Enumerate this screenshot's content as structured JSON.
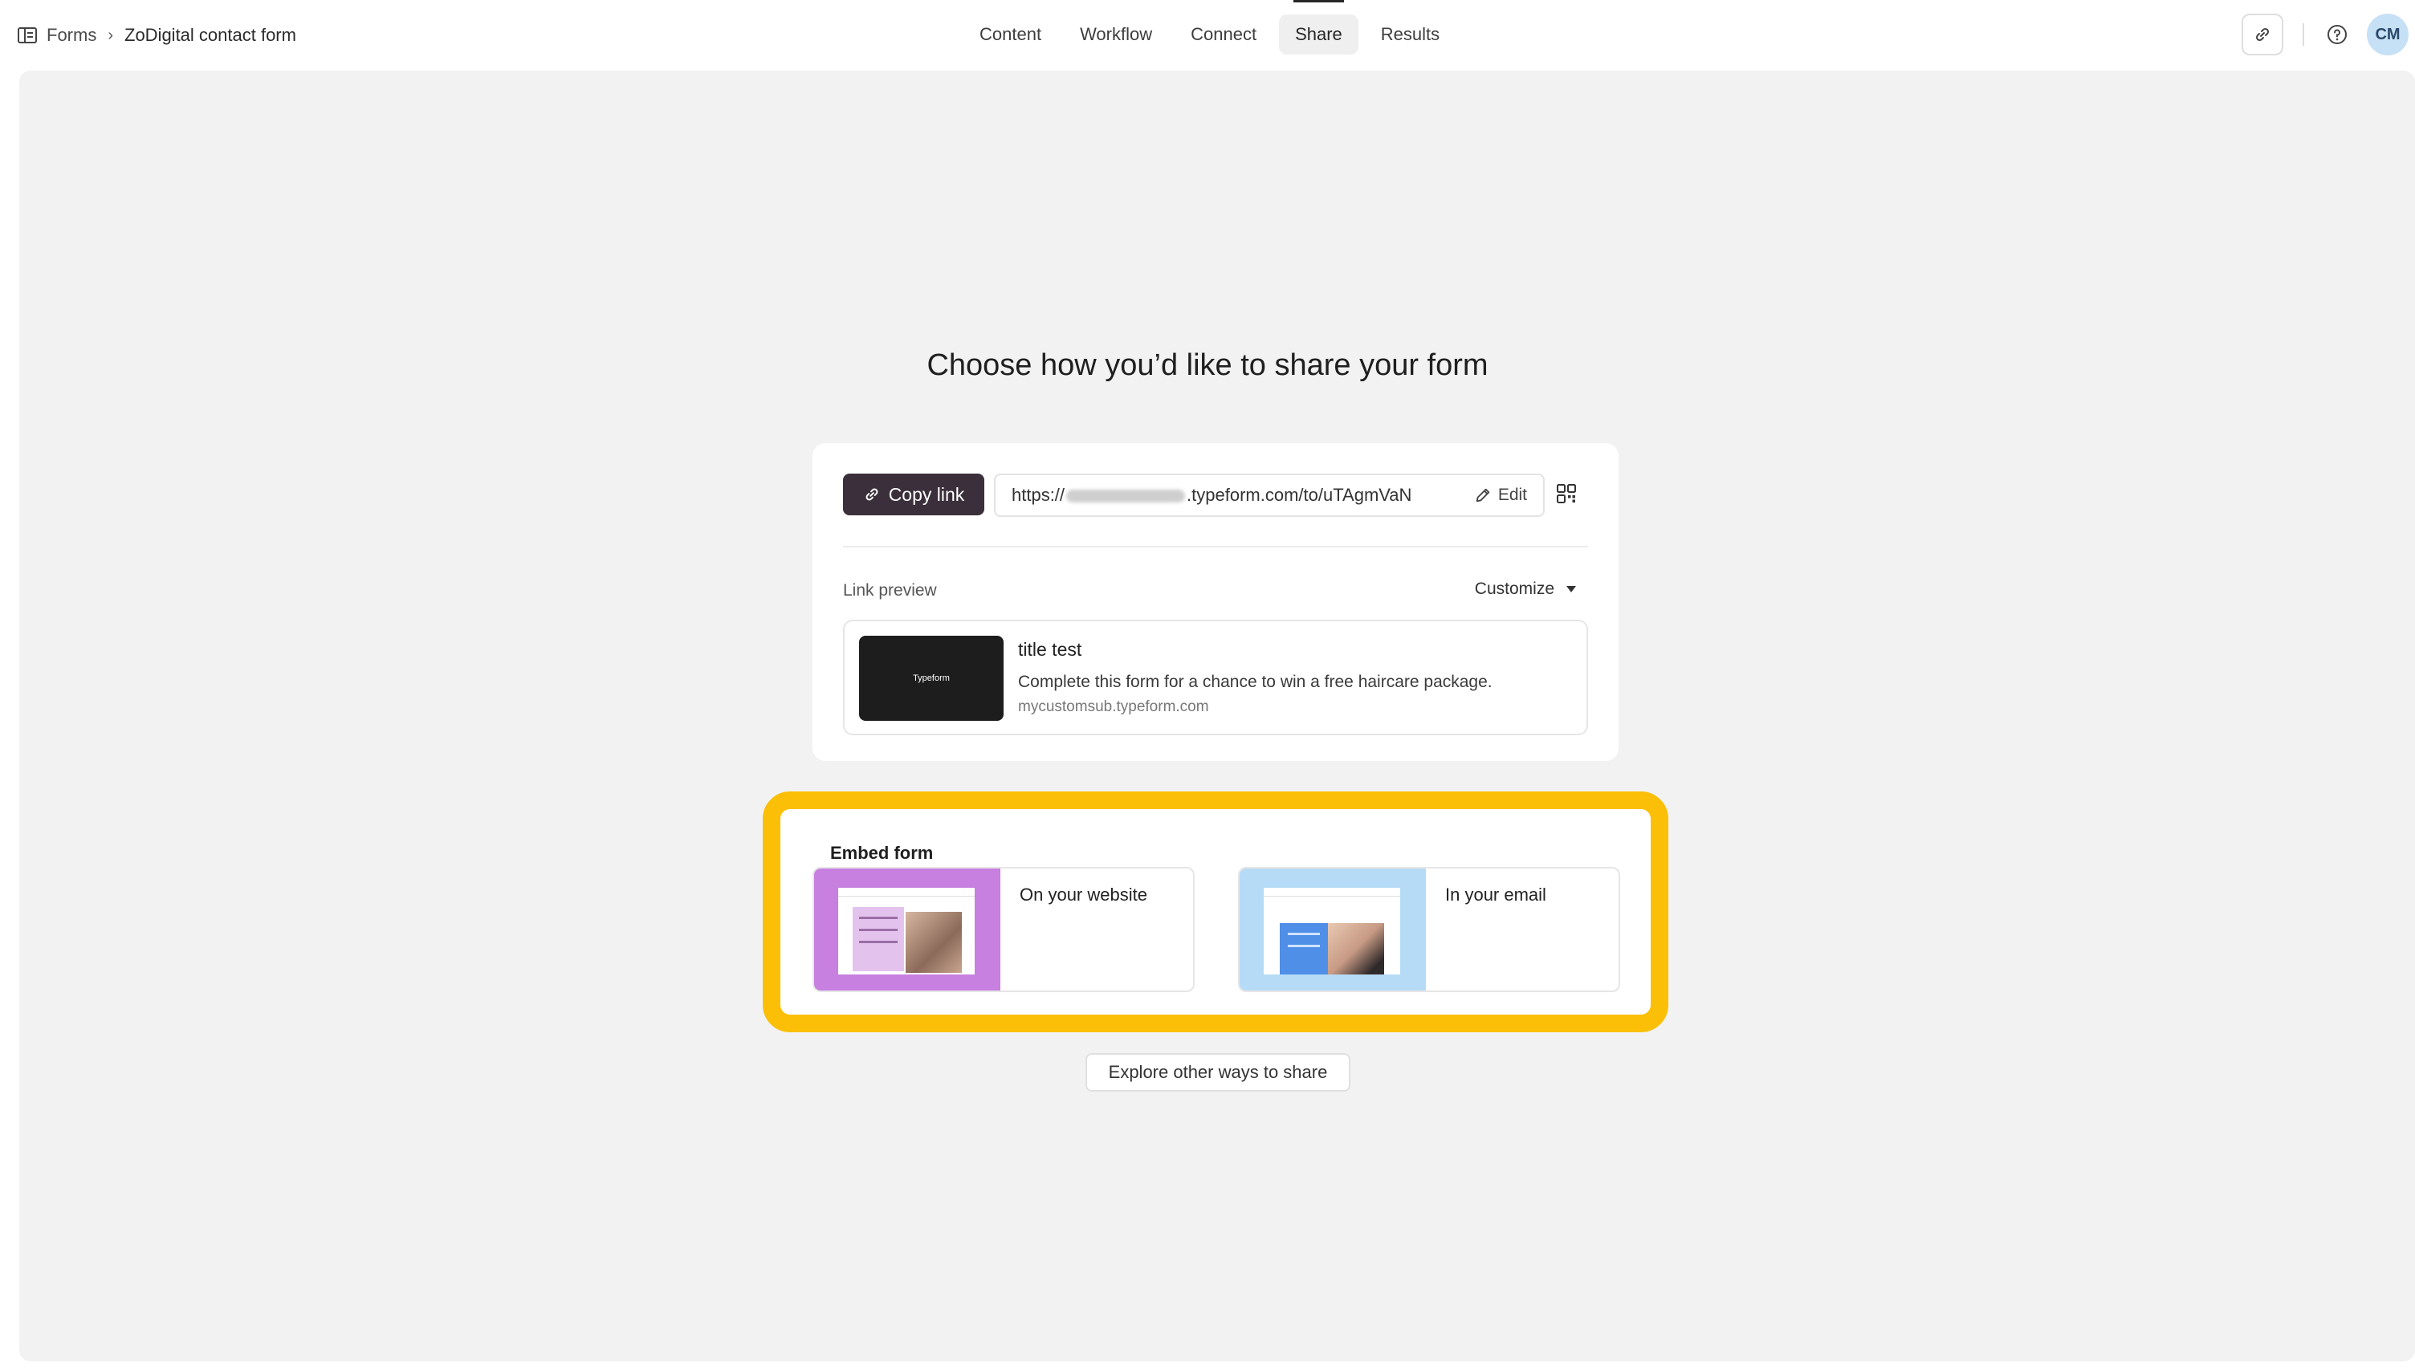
{
  "breadcrumb": {
    "root": "Forms",
    "current": "ZoDigital contact form"
  },
  "tabs": [
    {
      "label": "Content",
      "active": false
    },
    {
      "label": "Workflow",
      "active": false
    },
    {
      "label": "Connect",
      "active": false
    },
    {
      "label": "Share",
      "active": true
    },
    {
      "label": "Results",
      "active": false
    }
  ],
  "user": {
    "initials": "CM"
  },
  "main": {
    "headline": "Choose how you’d like to share your form",
    "copy_link_label": "Copy link",
    "url_prefix": "https://",
    "url_suffix": ".typeform.com/to/uTAgmVaN",
    "edit_label": "Edit",
    "link_preview_label": "Link preview",
    "customize_label": "Customize",
    "preview": {
      "thumb_text": "Typeform",
      "title": "title test",
      "description": "Complete this form for a chance to win a free haircare package.",
      "domain": "mycustomsub.typeform.com"
    },
    "embed": {
      "title": "Embed form",
      "options": [
        {
          "label": "On your website"
        },
        {
          "label": "In your email"
        }
      ]
    },
    "explore_label": "Explore other ways to share"
  },
  "colors": {
    "highlight": "#fbbf07",
    "copy_button": "#3a2f3a",
    "website_card": "#c77fe0",
    "email_card": "#b6dbf6"
  },
  "icons": [
    "forms-icon",
    "chevron-right-icon",
    "link-icon",
    "help-icon",
    "pencil-icon",
    "qr-code-icon",
    "caret-down-icon"
  ]
}
